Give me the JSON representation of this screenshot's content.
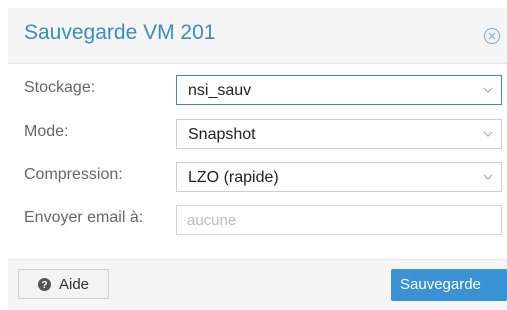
{
  "dialog": {
    "title": "Sauvegarde VM 201",
    "close_icon": "close-circle-icon"
  },
  "form": {
    "storage": {
      "label": "Stockage:",
      "value": "nsi_sauv"
    },
    "mode": {
      "label": "Mode:",
      "value": "Snapshot"
    },
    "compression": {
      "label": "Compression:",
      "value": "LZO (rapide)"
    },
    "email": {
      "label": "Envoyer email à:",
      "placeholder": "aucune",
      "value": ""
    }
  },
  "footer": {
    "help_label": "Aide",
    "help_icon": "question-circle-icon",
    "save_label": "Sauvegarde"
  },
  "colors": {
    "accent": "#3c8dbc",
    "primary_button": "#3892d3"
  }
}
